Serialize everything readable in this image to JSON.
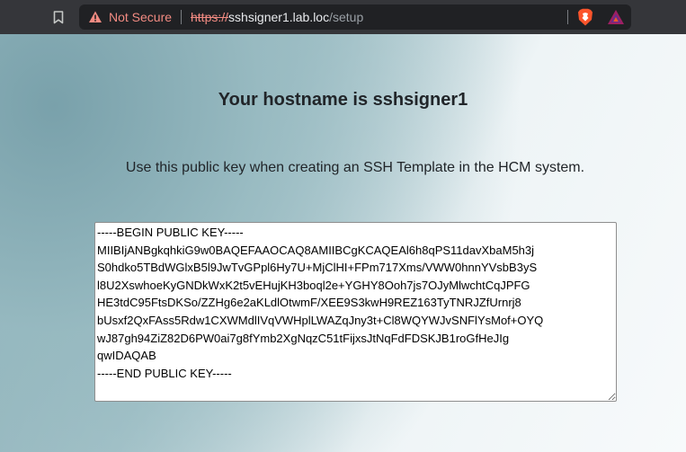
{
  "browser": {
    "security_label": "Not Secure",
    "url_scheme": "https://",
    "url_host": "sshsigner1.lab.loc",
    "url_path": "/setup",
    "icons": [
      "bookmark-icon",
      "warning-icon",
      "brave-shields-icon",
      "brave-rewards-icon"
    ]
  },
  "page": {
    "heading": "Your hostname is sshsigner1",
    "instruction": "Use this public key when creating an SSH Template in the HCM system.",
    "public_key": "-----BEGIN PUBLIC KEY-----\nMIIBIjANBgkqhkiG9w0BAQEFAAOCAQ8AMIIBCgKCAQEAl6h8qPS11davXbaM5h3j\nS0hdko5TBdWGlxB5l9JwTvGPpl6Hy7U+MjClHI+FPm717Xms/VWW0hnnYVsbB3yS\nl8U2XswhoeKyGNDkWxK2t5vEHujKH3boql2e+YGHY8Ooh7js7OJyMlwchtCqJPFG\nHE3tdC95FtsDKSo/ZZHg6e2aKLdlOtwmF/XEE9S3kwH9REZ163TyTNRJZfUrnrj8\nbUsxf2QxFAss5Rdw1CXWMdlIVqVWHplLWAZqJny3t+Cl8WQYWJvSNFlYsMof+OYQ\nwJ87gh94ZiZ82D6PW0ai7g8fYmb2XgNqzC51tFijxsJtNqFdFDSKJB1roGfHeJIg\nqwIDAQAB\n-----END PUBLIC KEY-----"
  }
}
